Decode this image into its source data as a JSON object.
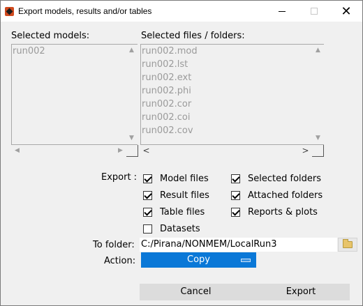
{
  "window": {
    "title": "Export models, results and/or tables",
    "controls": {
      "minimize": "–",
      "maximize": "□",
      "close": "✕"
    }
  },
  "models": {
    "label": "Selected models:",
    "items": [
      "run002"
    ]
  },
  "files": {
    "label": "Selected files / folders:",
    "items": [
      "run002.mod",
      "run002.lst",
      "run002.ext",
      "run002.phi",
      "run002.cor",
      "run002.coi",
      "run002.cov"
    ]
  },
  "scroll": {
    "up": "▲",
    "down": "▼",
    "left": "◀",
    "right": "▶",
    "left_active": "<",
    "right_active": ">"
  },
  "export": {
    "label": "Export :",
    "options": [
      {
        "label": "Model files",
        "checked": true
      },
      {
        "label": "Selected folders",
        "checked": true
      },
      {
        "label": "Result files",
        "checked": true
      },
      {
        "label": "Attached folders",
        "checked": true
      },
      {
        "label": "Table files",
        "checked": true
      },
      {
        "label": "Reports & plots",
        "checked": true
      },
      {
        "label": "Datasets",
        "checked": false
      }
    ]
  },
  "to_folder": {
    "label": "To folder:",
    "value": "C:/Pirana/NONMEM/LocalRun3",
    "browse_icon": "folder-icon"
  },
  "action": {
    "label": "Action:",
    "selected": "Copy"
  },
  "buttons": {
    "cancel": "Cancel",
    "export": "Export"
  },
  "colors": {
    "accent": "#0a78d7",
    "disabled_text": "#9a9a9a",
    "window_bg": "#f0f0f0"
  }
}
